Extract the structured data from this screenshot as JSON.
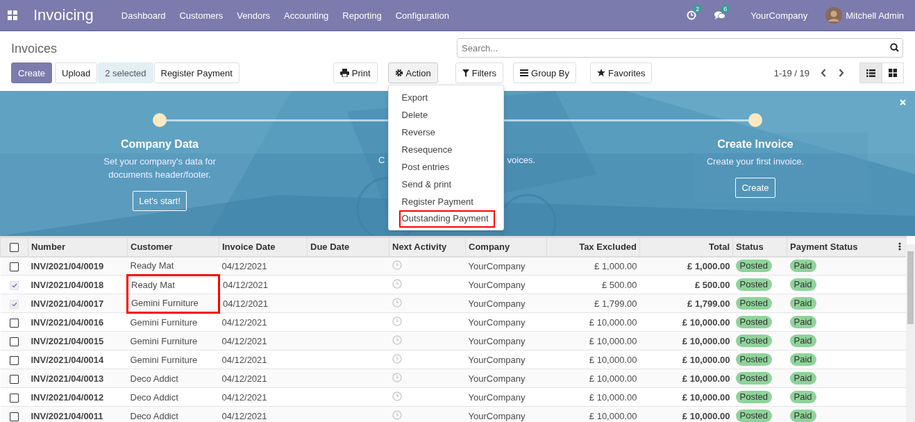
{
  "app": {
    "title": "Invoicing",
    "menu": [
      "Dashboard",
      "Customers",
      "Vendors",
      "Accounting",
      "Reporting",
      "Configuration"
    ],
    "activity_count": "2",
    "message_count": "6",
    "company": "YourCompany",
    "user": "Mitchell Admin"
  },
  "page": {
    "title": "Invoices",
    "search": {
      "placeholder": "Search..."
    },
    "buttons": [
      {
        "label": "Create",
        "kind": "primary"
      },
      {
        "label": "Upload",
        "kind": "default"
      },
      {
        "label": "2 selected",
        "kind": "info"
      },
      {
        "label": "Register Payment",
        "kind": "default"
      }
    ],
    "print": "Print",
    "action": {
      "label": "Action",
      "expanded": true,
      "items": [
        {
          "label": "Export",
          "highlighted": false
        },
        {
          "label": "Delete",
          "highlighted": false
        },
        {
          "label": "Reverse",
          "highlighted": false
        },
        {
          "label": "Resequence",
          "highlighted": false
        },
        {
          "label": "Post entries",
          "highlighted": false
        },
        {
          "label": "Send & print",
          "highlighted": false
        },
        {
          "label": "Register Payment",
          "highlighted": false
        },
        {
          "label": "Outstanding Payment",
          "highlighted": true
        }
      ]
    },
    "filters": "Filters",
    "group_by": "Group By",
    "favorites": "Favorites",
    "pager": "1-19 / 19",
    "views": [
      {
        "kind": "list",
        "selected": true
      },
      {
        "kind": "kanban",
        "selected": false
      }
    ]
  },
  "banner": {
    "steps": [
      {
        "title": "Company Data",
        "description": "Set your company's data for documents header/footer.",
        "button": "Let's start!"
      },
      {
        "description_parts": [
          "C",
          "voices."
        ]
      },
      {
        "title": "Create Invoice",
        "description": "Create your first invoice.",
        "button": "Create"
      }
    ]
  },
  "table": {
    "header_checked": false,
    "columns": [
      {
        "label": "Number",
        "kind": "text"
      },
      {
        "label": "Customer",
        "kind": "text"
      },
      {
        "label": "Invoice Date",
        "kind": "text"
      },
      {
        "label": "Due Date",
        "kind": "text"
      },
      {
        "label": "Next Activity",
        "kind": "text"
      },
      {
        "label": "Company",
        "kind": "text"
      },
      {
        "label": "Tax Excluded",
        "kind": "amount"
      },
      {
        "label": "Total",
        "kind": "amount"
      },
      {
        "label": "Status",
        "kind": "text"
      },
      {
        "label": "Payment Status",
        "kind": "text"
      }
    ],
    "rows": [
      {
        "number": "INV/2021/04/0019",
        "customer": "Ready Mat",
        "invoice_date": "04/12/2021",
        "company": "YourCompany",
        "tax_excluded": "£ 1,000.00",
        "total": "£ 1,000.00",
        "status": "Posted",
        "payment_status": "Paid",
        "checked": false,
        "customer_highlighted": false
      },
      {
        "number": "INV/2021/04/0018",
        "customer": "Ready Mat",
        "invoice_date": "04/12/2021",
        "company": "YourCompany",
        "tax_excluded": "£ 500.00",
        "total": "£ 500.00",
        "status": "Posted",
        "payment_status": "Paid",
        "checked": true,
        "customer_highlighted": true
      },
      {
        "number": "INV/2021/04/0017",
        "customer": "Gemini Furniture",
        "invoice_date": "04/12/2021",
        "company": "YourCompany",
        "tax_excluded": "£ 1,799.00",
        "total": "£ 1,799.00",
        "status": "Posted",
        "payment_status": "Paid",
        "checked": true,
        "customer_highlighted": true
      },
      {
        "number": "INV/2021/04/0016",
        "customer": "Gemini Furniture",
        "invoice_date": "04/12/2021",
        "company": "YourCompany",
        "tax_excluded": "£ 10,000.00",
        "total": "£ 10,000.00",
        "status": "Posted",
        "payment_status": "Paid",
        "checked": false,
        "customer_highlighted": false
      },
      {
        "number": "INV/2021/04/0015",
        "customer": "Gemini Furniture",
        "invoice_date": "04/12/2021",
        "company": "YourCompany",
        "tax_excluded": "£ 10,000.00",
        "total": "£ 10,000.00",
        "status": "Posted",
        "payment_status": "Paid",
        "checked": false,
        "customer_highlighted": false
      },
      {
        "number": "INV/2021/04/0014",
        "customer": "Gemini Furniture",
        "invoice_date": "04/12/2021",
        "company": "YourCompany",
        "tax_excluded": "£ 10,000.00",
        "total": "£ 10,000.00",
        "status": "Posted",
        "payment_status": "Paid",
        "checked": false,
        "customer_highlighted": false
      },
      {
        "number": "INV/2021/04/0013",
        "customer": "Deco Addict",
        "invoice_date": "04/12/2021",
        "company": "YourCompany",
        "tax_excluded": "£ 10,000.00",
        "total": "£ 10,000.00",
        "status": "Posted",
        "payment_status": "Paid",
        "checked": false,
        "customer_highlighted": false
      },
      {
        "number": "INV/2021/04/0012",
        "customer": "Deco Addict",
        "invoice_date": "04/12/2021",
        "company": "YourCompany",
        "tax_excluded": "£ 10,000.00",
        "total": "£ 10,000.00",
        "status": "Posted",
        "payment_status": "Paid",
        "checked": false,
        "customer_highlighted": false
      },
      {
        "number": "INV/2021/04/0011",
        "customer": "Deco Addict",
        "invoice_date": "04/12/2021",
        "company": "YourCompany",
        "tax_excluded": "£ 10,000.00",
        "total": "£ 10,000.00",
        "status": "Posted",
        "payment_status": "Paid",
        "checked": false,
        "customer_highlighted": false
      }
    ]
  }
}
